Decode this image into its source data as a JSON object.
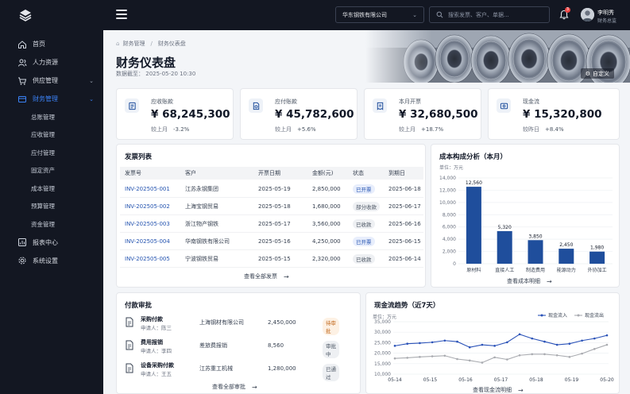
{
  "sidebar": {
    "items": [
      {
        "label": "首页",
        "icon": "home-icon"
      },
      {
        "label": "人力资源",
        "icon": "users-icon"
      },
      {
        "label": "供应管理",
        "icon": "cart-icon"
      },
      {
        "label": "财务管理",
        "icon": "finance-icon"
      }
    ],
    "finance_sub": [
      "总账管理",
      "应收管理",
      "应付管理",
      "固定资产",
      "成本管理",
      "预算管理",
      "资金管理"
    ],
    "bottom_items": [
      {
        "label": "报表中心",
        "icon": "report-icon"
      },
      {
        "label": "系统设置",
        "icon": "settings-icon"
      }
    ]
  },
  "topbar": {
    "company": "华东钢铁有限公司",
    "search_placeholder": "搜索发票、客户、单据...",
    "notification_count": "3",
    "user_name": "李明秀",
    "user_role": "财务总监"
  },
  "header": {
    "breadcrumb": [
      "财务管理",
      "财务仪表盘"
    ],
    "title": "财务仪表盘",
    "date_label": "数据截至：",
    "date_value": "2025-05-20  10:30",
    "custom_button": "自定义"
  },
  "kpis": [
    {
      "label": "应收账款",
      "value": "¥ 68,245,300",
      "compare": "较上月",
      "delta": "-3.2%",
      "icon": "receivable-icon"
    },
    {
      "label": "应付账款",
      "value": "¥ 45,782,600",
      "compare": "较上月",
      "delta": "+5.6%",
      "icon": "payable-icon"
    },
    {
      "label": "本月开票",
      "value": "¥ 32,680,500",
      "compare": "较上月",
      "delta": "+18.7%",
      "icon": "invoice-icon"
    },
    {
      "label": "现金流",
      "value": "¥ 15,320,800",
      "compare": "较昨日",
      "delta": "+8.4%",
      "icon": "cash-icon"
    }
  ],
  "invoices": {
    "title": "发票列表",
    "columns": [
      "发票号",
      "客户",
      "开票日期",
      "金额(元)",
      "状态",
      "到期日"
    ],
    "rows": [
      {
        "no": "INV-202505-001",
        "customer": "江苏永钢集团",
        "date": "2025-05-19",
        "amount": "2,850,000",
        "status": "已开票",
        "status_type": "blue",
        "due": "2025-06-18"
      },
      {
        "no": "INV-202505-002",
        "customer": "上海宝钢贸易",
        "date": "2025-05-18",
        "amount": "1,680,000",
        "status": "部分收款",
        "status_type": "gray",
        "due": "2025-06-17"
      },
      {
        "no": "INV-202505-003",
        "customer": "浙江物产钢铁",
        "date": "2025-05-17",
        "amount": "3,560,000",
        "status": "已收款",
        "status_type": "gray",
        "due": "2025-06-16"
      },
      {
        "no": "INV-202505-004",
        "customer": "华南钢铁有限公司",
        "date": "2025-05-16",
        "amount": "4,250,000",
        "status": "已开票",
        "status_type": "blue",
        "due": "2025-06-15"
      },
      {
        "no": "INV-202505-005",
        "customer": "宁波钢铁贸易",
        "date": "2025-05-15",
        "amount": "2,320,000",
        "status": "已收款",
        "status_type": "gray",
        "due": "2025-06-14"
      }
    ],
    "view_all": "查看全部发票"
  },
  "cost": {
    "title": "成本构成分析（本月）",
    "view_all": "查看成本明细"
  },
  "approvals": {
    "title": "付款审批",
    "rows": [
      {
        "title": "采购付款",
        "requester": "申请人：陈三",
        "company": "上海钢材有限公司",
        "amount": "2,450,000",
        "status": "待审批",
        "status_type": "orange"
      },
      {
        "title": "费用报销",
        "requester": "申请人：李四",
        "company": "差旅费报销",
        "amount": "8,560",
        "status": "审批中",
        "status_type": "gray"
      },
      {
        "title": "设备采购付款",
        "requester": "申请人：王五",
        "company": "江苏重工机械",
        "amount": "1,280,000",
        "status": "已通过",
        "status_type": "gray"
      }
    ],
    "view_all": "查看全部审批"
  },
  "cashflow": {
    "title": "现金流趋势（近7天）",
    "view_all": "查看现金流明细"
  },
  "colors": {
    "accent": "#1f4e9c",
    "sidebar_bg": "#131722",
    "inflow": "#2a52b8",
    "outflow": "#a9abb0"
  },
  "chart_data": [
    {
      "type": "bar",
      "title": "成本构成分析（本月）",
      "ylabel": "单位：万元",
      "categories": [
        "原材料",
        "直接人工",
        "制造费用",
        "能源动力",
        "外协加工"
      ],
      "values": [
        12560,
        5320,
        3850,
        2450,
        1980
      ],
      "data_labels": [
        "12,560",
        "5,320",
        "3,850",
        "2,450",
        "1,980"
      ],
      "ylim": [
        0,
        14000
      ],
      "yticks": [
        "0",
        "2,000",
        "4,000",
        "6,000",
        "8,000",
        "10,000",
        "12,000",
        "14,000"
      ],
      "grid": true
    },
    {
      "type": "line",
      "title": "现金流趋势（近7天）",
      "ylabel": "单位：万元",
      "x": [
        "05-14",
        "05-15",
        "05-16",
        "05-17",
        "05-18",
        "05-19",
        "05-20"
      ],
      "x_points": 18,
      "series": [
        {
          "name": "现金流入",
          "values": [
            23500,
            24500,
            24800,
            25200,
            26000,
            25500,
            22800,
            24000,
            23500,
            25200,
            29000,
            27000,
            25500,
            24000,
            24500,
            26000,
            27000,
            28500
          ]
        },
        {
          "name": "现金流出",
          "values": [
            17500,
            17800,
            18200,
            18500,
            18800,
            17200,
            16500,
            15500,
            18000,
            17000,
            19000,
            19500,
            19500,
            19000,
            18200,
            19800,
            22000,
            24000
          ]
        }
      ],
      "ylim": [
        10000,
        35000
      ],
      "yticks": [
        "10,000",
        "15,000",
        "20,000",
        "25,000",
        "30,000",
        "35,000"
      ],
      "legend": "top-right",
      "grid": true
    }
  ]
}
